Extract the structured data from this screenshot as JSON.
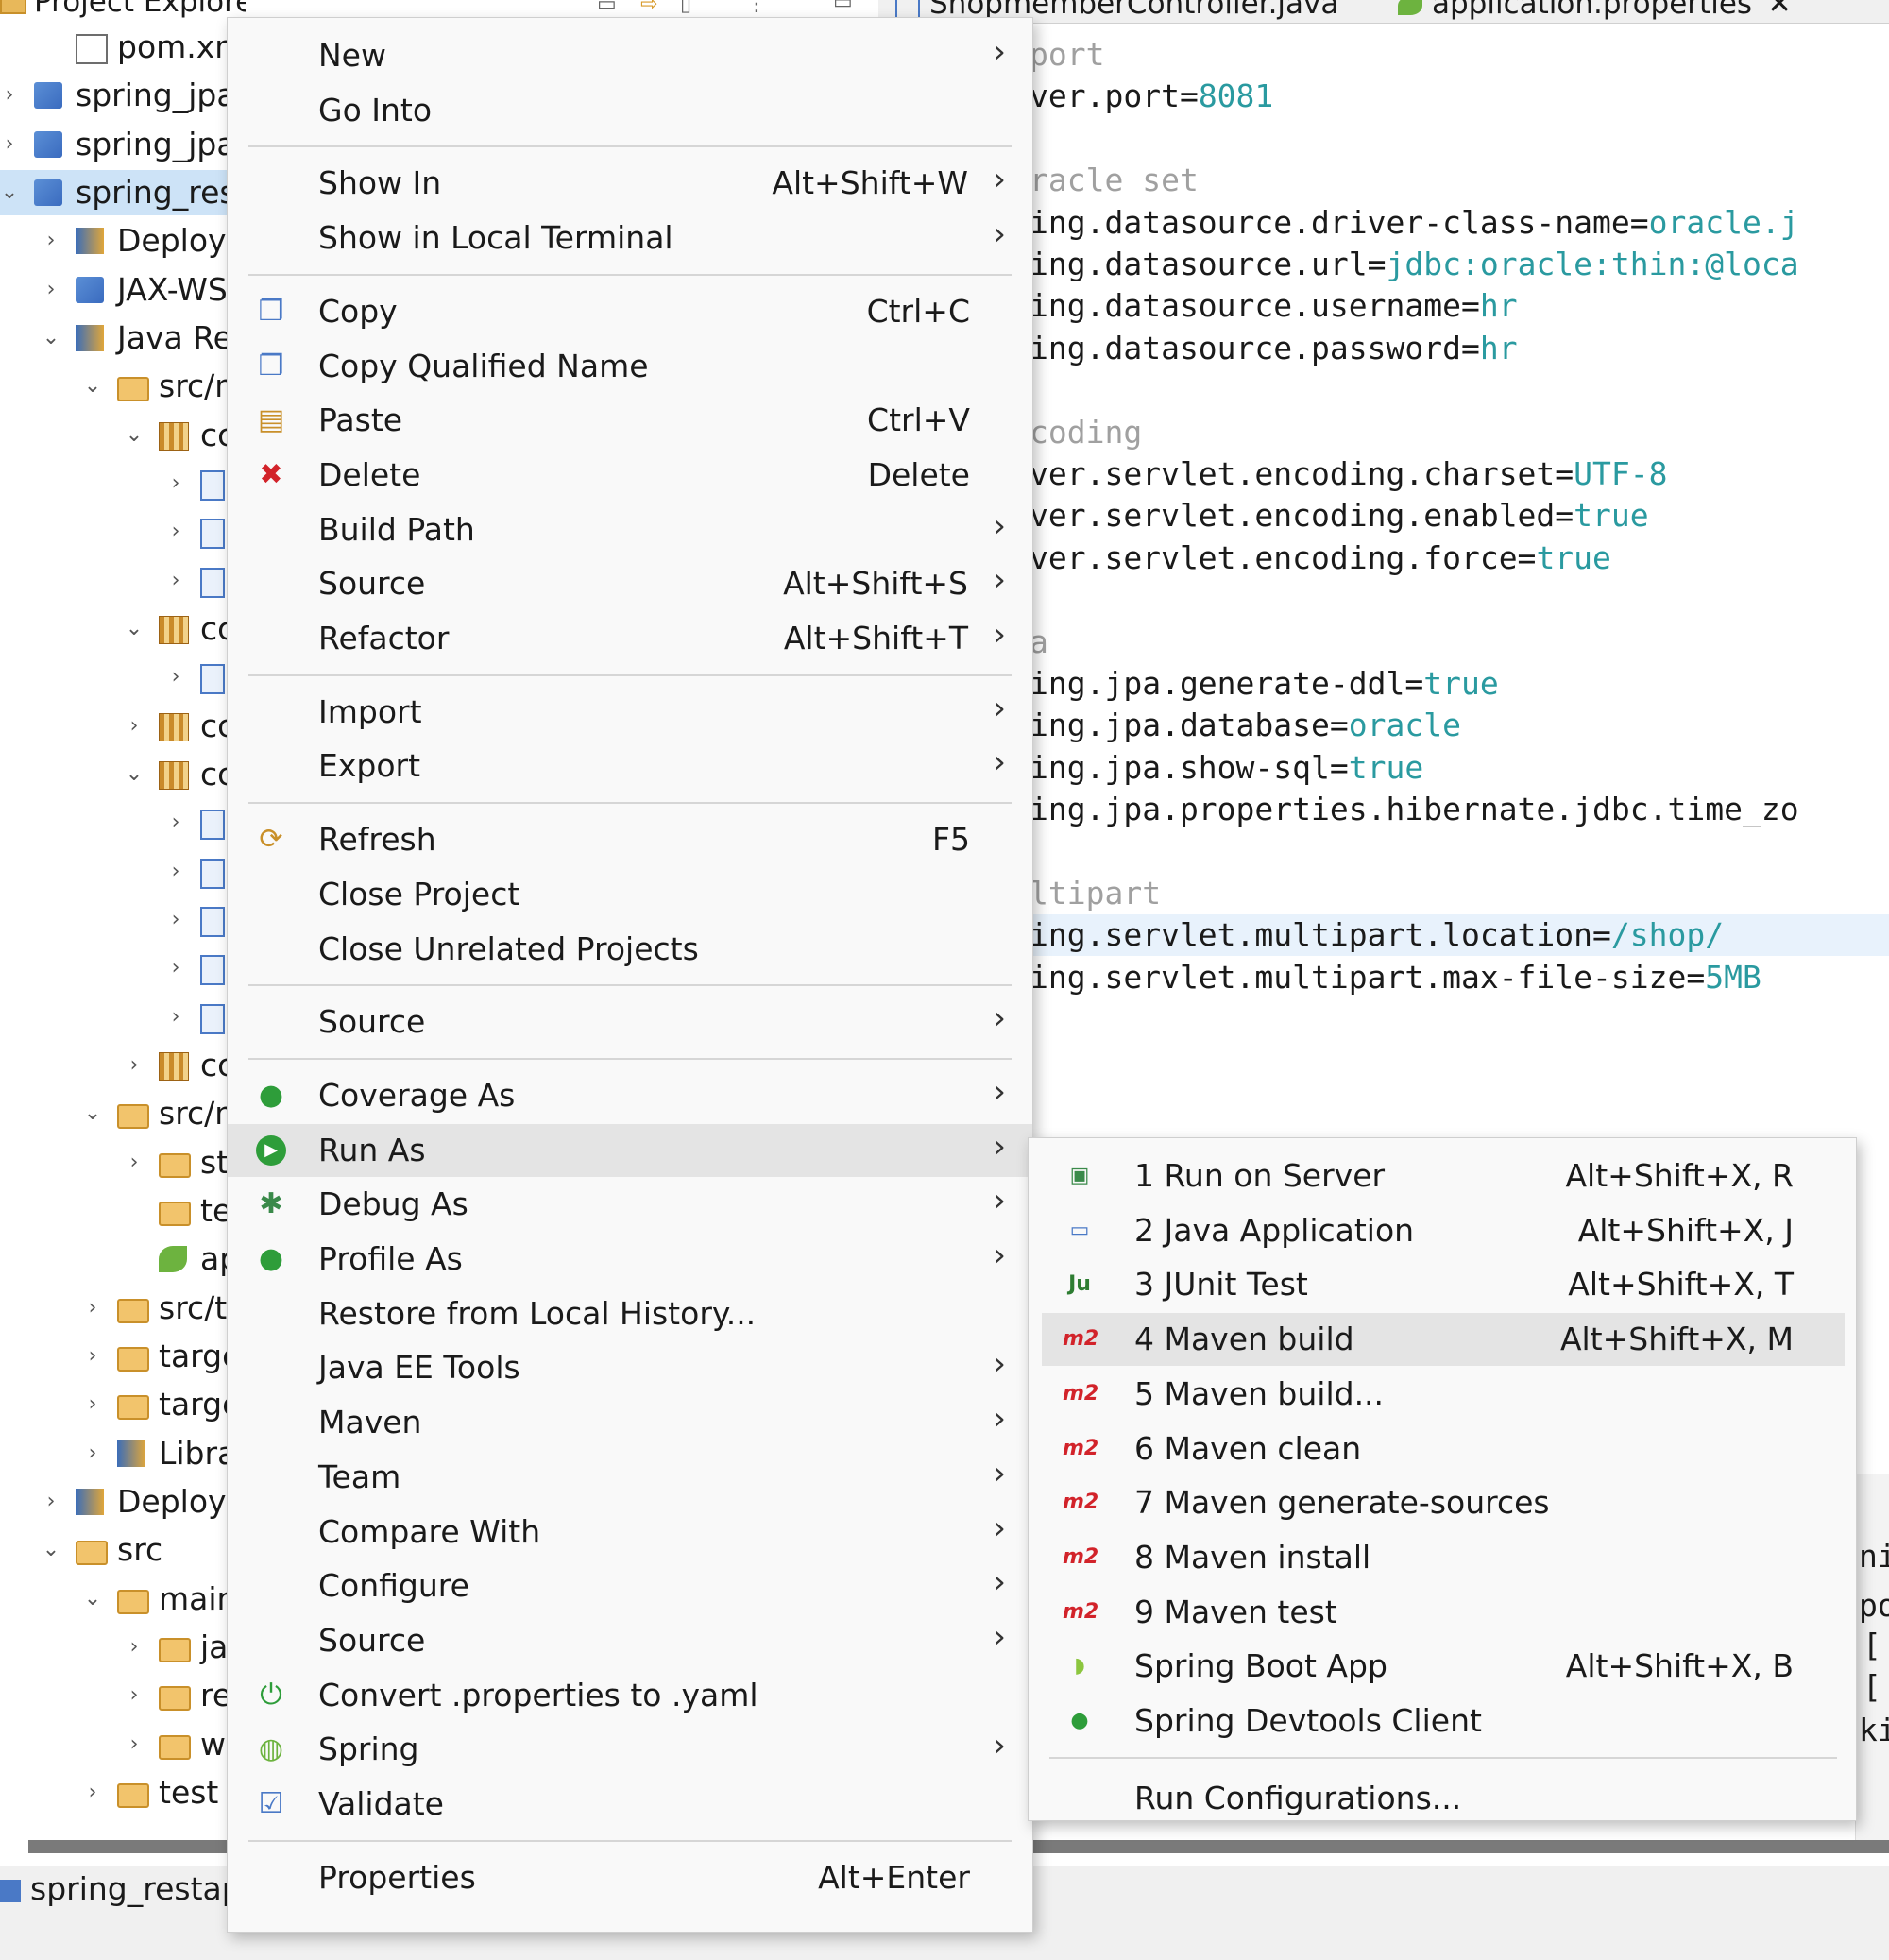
{
  "explorer": {
    "title": "Project Explorer",
    "rows": [
      {
        "label": "pom.xm",
        "chev": "",
        "icon": "xml",
        "indent": 1
      },
      {
        "label": "spring_jpa_",
        "chev": "›",
        "icon": "project",
        "indent": 0
      },
      {
        "label": "spring_jpa-",
        "chev": "›",
        "icon": "project",
        "indent": 0
      },
      {
        "label": "spring_rest",
        "chev": "⌄",
        "icon": "project",
        "indent": 0,
        "selected": true
      },
      {
        "label": "Deploy",
        "chev": "›",
        "icon": "deploy",
        "indent": 1
      },
      {
        "label": "JAX-WS",
        "chev": "›",
        "icon": "jaxws",
        "indent": 1
      },
      {
        "label": "Java Re",
        "chev": "⌄",
        "icon": "lib",
        "indent": 1
      },
      {
        "label": "src/n",
        "chev": "⌄",
        "icon": "folder",
        "indent": 2
      },
      {
        "label": "cc",
        "chev": "⌄",
        "icon": "pkg",
        "indent": 3
      },
      {
        "label": "",
        "chev": "›",
        "icon": "java",
        "indent": 4
      },
      {
        "label": "",
        "chev": "›",
        "icon": "java",
        "indent": 4
      },
      {
        "label": "",
        "chev": "›",
        "icon": "java",
        "indent": 4
      },
      {
        "label": "cc",
        "chev": "⌄",
        "icon": "pkg",
        "indent": 3
      },
      {
        "label": "",
        "chev": "›",
        "icon": "java",
        "indent": 4
      },
      {
        "label": "cc",
        "chev": "›",
        "icon": "pkg",
        "indent": 3
      },
      {
        "label": "cc",
        "chev": "⌄",
        "icon": "pkg",
        "indent": 3
      },
      {
        "label": "",
        "chev": "›",
        "icon": "java",
        "indent": 4
      },
      {
        "label": "",
        "chev": "›",
        "icon": "java",
        "indent": 4
      },
      {
        "label": "",
        "chev": "›",
        "icon": "java",
        "indent": 4
      },
      {
        "label": "",
        "chev": "›",
        "icon": "java",
        "indent": 4
      },
      {
        "label": "",
        "chev": "›",
        "icon": "java",
        "indent": 4
      },
      {
        "label": "cc",
        "chev": "›",
        "icon": "pkg",
        "indent": 3
      },
      {
        "label": "src/n",
        "chev": "⌄",
        "icon": "folder",
        "indent": 2
      },
      {
        "label": "st",
        "chev": "›",
        "icon": "folder",
        "indent": 3
      },
      {
        "label": "te",
        "chev": "",
        "icon": "folder",
        "indent": 3
      },
      {
        "label": "ap",
        "chev": "",
        "icon": "leaf",
        "indent": 3
      },
      {
        "label": "src/t",
        "chev": "›",
        "icon": "folder",
        "indent": 2
      },
      {
        "label": "targe",
        "chev": "›",
        "icon": "folder",
        "indent": 2
      },
      {
        "label": "targe",
        "chev": "›",
        "icon": "folder",
        "indent": 2
      },
      {
        "label": "Libra",
        "chev": "›",
        "icon": "lib",
        "indent": 2
      },
      {
        "label": "Deploye",
        "chev": "›",
        "icon": "deploy",
        "indent": 1
      },
      {
        "label": "src",
        "chev": "⌄",
        "icon": "folder",
        "indent": 1
      },
      {
        "label": "main",
        "chev": "⌄",
        "icon": "folder",
        "indent": 2
      },
      {
        "label": "ja",
        "chev": "›",
        "icon": "folder",
        "indent": 3
      },
      {
        "label": "re",
        "chev": "›",
        "icon": "folder",
        "indent": 3
      },
      {
        "label": "w",
        "chev": "›",
        "icon": "folder",
        "indent": 3
      },
      {
        "label": "test",
        "chev": "›",
        "icon": "folder",
        "indent": 2
      }
    ]
  },
  "editor": {
    "tabs": [
      "ShopmemberController.java",
      "application.properties"
    ],
    "lines": [
      {
        "parts": [
          {
            "t": "port",
            "c": "cm"
          }
        ],
        "comment": true
      },
      {
        "parts": [
          {
            "t": "ver.port=",
            "c": "k"
          },
          {
            "t": "8081",
            "c": "v"
          }
        ]
      },
      {
        "parts": [],
        "blank": true
      },
      {
        "parts": [
          {
            "t": "racle set",
            "c": "cm"
          }
        ],
        "comment": true
      },
      {
        "parts": [
          {
            "t": "ing.datasource.driver-class-name=",
            "c": "k"
          },
          {
            "t": "oracle.j",
            "c": "v"
          }
        ]
      },
      {
        "parts": [
          {
            "t": "ing.datasource.url=",
            "c": "k"
          },
          {
            "t": "jdbc:oracle:thin:@loca",
            "c": "v"
          }
        ]
      },
      {
        "parts": [
          {
            "t": "ing.datasource.username=",
            "c": "k"
          },
          {
            "t": "hr",
            "c": "v"
          }
        ]
      },
      {
        "parts": [
          {
            "t": "ing.datasource.password=",
            "c": "k"
          },
          {
            "t": "hr",
            "c": "v"
          }
        ]
      },
      {
        "parts": [],
        "blank": true
      },
      {
        "parts": [
          {
            "t": "coding",
            "c": "cm"
          }
        ],
        "comment": true
      },
      {
        "parts": [
          {
            "t": "ver.servlet.encoding.charset=",
            "c": "k"
          },
          {
            "t": "UTF-8",
            "c": "v"
          }
        ]
      },
      {
        "parts": [
          {
            "t": "ver.servlet.encoding.enabled=",
            "c": "k"
          },
          {
            "t": "true",
            "c": "v"
          }
        ]
      },
      {
        "parts": [
          {
            "t": "ver.servlet.encoding.force=",
            "c": "k"
          },
          {
            "t": "true",
            "c": "v"
          }
        ]
      },
      {
        "parts": [],
        "blank": true
      },
      {
        "parts": [
          {
            "t": "a",
            "c": "cm"
          }
        ],
        "comment": true
      },
      {
        "parts": [
          {
            "t": "ing.jpa.generate-ddl=",
            "c": "k"
          },
          {
            "t": "true",
            "c": "v"
          }
        ]
      },
      {
        "parts": [
          {
            "t": "ing.jpa.database=",
            "c": "k"
          },
          {
            "t": "oracle",
            "c": "v"
          }
        ]
      },
      {
        "parts": [
          {
            "t": "ing.jpa.show-sql=",
            "c": "k"
          },
          {
            "t": "true",
            "c": "v"
          }
        ]
      },
      {
        "parts": [
          {
            "t": "ing.jpa.properties.hibernate.jdbc.time_zo",
            "c": "k"
          }
        ]
      },
      {
        "parts": [],
        "blank": true
      },
      {
        "parts": [
          {
            "t": "ltipart",
            "c": "cm"
          }
        ],
        "comment": true
      },
      {
        "parts": [
          {
            "t": "ing.servlet.multipart.location=",
            "c": "k"
          },
          {
            "t": "/shop/",
            "c": "v"
          }
        ],
        "highlight": true
      },
      {
        "parts": [
          {
            "t": "ing.servlet.multipart.max-file-size=",
            "c": "k"
          },
          {
            "t": "5MB",
            "c": "v"
          }
        ]
      }
    ]
  },
  "context_menu": {
    "items": [
      {
        "label": "New",
        "shortcut": "",
        "submenu": true,
        "icon": "",
        "name": "new"
      },
      {
        "label": "Go Into",
        "shortcut": "",
        "submenu": false,
        "icon": "",
        "name": "go-into"
      },
      {
        "sep": true
      },
      {
        "label": "Show In",
        "shortcut": "Alt+Shift+W",
        "submenu": true,
        "icon": "",
        "name": "show-in"
      },
      {
        "label": "Show in Local Terminal",
        "shortcut": "",
        "submenu": true,
        "icon": "",
        "name": "show-in-local-terminal"
      },
      {
        "sep": true
      },
      {
        "label": "Copy",
        "shortcut": "Ctrl+C",
        "submenu": false,
        "icon": "copy",
        "name": "copy"
      },
      {
        "label": "Copy Qualified Name",
        "shortcut": "",
        "submenu": false,
        "icon": "copy-qualified",
        "name": "copy-qualified-name"
      },
      {
        "label": "Paste",
        "shortcut": "Ctrl+V",
        "submenu": false,
        "icon": "paste",
        "name": "paste"
      },
      {
        "label": "Delete",
        "shortcut": "Delete",
        "submenu": false,
        "icon": "delete",
        "name": "delete"
      },
      {
        "label": "Build Path",
        "shortcut": "",
        "submenu": true,
        "icon": "",
        "name": "build-path"
      },
      {
        "label": "Source",
        "shortcut": "Alt+Shift+S",
        "submenu": true,
        "icon": "",
        "name": "source"
      },
      {
        "label": "Refactor",
        "shortcut": "Alt+Shift+T",
        "submenu": true,
        "icon": "",
        "name": "refactor"
      },
      {
        "sep": true
      },
      {
        "label": "Import",
        "shortcut": "",
        "submenu": true,
        "icon": "",
        "name": "import"
      },
      {
        "label": "Export",
        "shortcut": "",
        "submenu": true,
        "icon": "",
        "name": "export"
      },
      {
        "sep": true
      },
      {
        "label": "Refresh",
        "shortcut": "F5",
        "submenu": false,
        "icon": "refresh",
        "name": "refresh"
      },
      {
        "label": "Close Project",
        "shortcut": "",
        "submenu": false,
        "icon": "",
        "name": "close-project"
      },
      {
        "label": "Close Unrelated Projects",
        "shortcut": "",
        "submenu": false,
        "icon": "",
        "name": "close-unrelated-projects"
      },
      {
        "sep": true
      },
      {
        "label": "Source",
        "shortcut": "",
        "submenu": true,
        "icon": "",
        "name": "source-2"
      },
      {
        "sep": true
      },
      {
        "label": "Coverage As",
        "shortcut": "",
        "submenu": true,
        "icon": "coverage",
        "name": "coverage-as"
      },
      {
        "label": "Run As",
        "shortcut": "",
        "submenu": true,
        "icon": "run",
        "name": "run-as",
        "hover": true
      },
      {
        "label": "Debug As",
        "shortcut": "",
        "submenu": true,
        "icon": "debug",
        "name": "debug-as"
      },
      {
        "label": "Profile As",
        "shortcut": "",
        "submenu": true,
        "icon": "profile",
        "name": "profile-as"
      },
      {
        "label": "Restore from Local History...",
        "shortcut": "",
        "submenu": false,
        "icon": "",
        "name": "restore-local-history"
      },
      {
        "label": "Java EE Tools",
        "shortcut": "",
        "submenu": true,
        "icon": "",
        "name": "java-ee-tools"
      },
      {
        "label": "Maven",
        "shortcut": "",
        "submenu": true,
        "icon": "",
        "name": "maven"
      },
      {
        "label": "Team",
        "shortcut": "",
        "submenu": true,
        "icon": "",
        "name": "team"
      },
      {
        "label": "Compare With",
        "shortcut": "",
        "submenu": true,
        "icon": "",
        "name": "compare-with"
      },
      {
        "label": "Configure",
        "shortcut": "",
        "submenu": true,
        "icon": "",
        "name": "configure"
      },
      {
        "label": "Source",
        "shortcut": "",
        "submenu": true,
        "icon": "",
        "name": "source-3"
      },
      {
        "label": "Convert .properties to .yaml",
        "shortcut": "",
        "submenu": false,
        "icon": "convert",
        "name": "convert-properties-yaml"
      },
      {
        "label": "Spring",
        "shortcut": "",
        "submenu": true,
        "icon": "spring",
        "name": "spring"
      },
      {
        "label": "Validate",
        "shortcut": "",
        "submenu": false,
        "icon": "validate",
        "name": "validate"
      },
      {
        "sep": true
      },
      {
        "label": "Properties",
        "shortcut": "Alt+Enter",
        "submenu": false,
        "icon": "",
        "name": "properties"
      }
    ]
  },
  "run_as_menu": {
    "items": [
      {
        "label": "1 Run on Server",
        "shortcut": "Alt+Shift+X, R",
        "icon": "server",
        "name": "run-on-server"
      },
      {
        "label": "2 Java Application",
        "shortcut": "Alt+Shift+X, J",
        "icon": "java-app",
        "name": "java-application"
      },
      {
        "label": "3 JUnit Test",
        "shortcut": "Alt+Shift+X, T",
        "icon": "junit",
        "name": "junit-test"
      },
      {
        "label": "4 Maven build",
        "shortcut": "Alt+Shift+X, M",
        "icon": "m2",
        "name": "maven-build",
        "hover": true
      },
      {
        "label": "5 Maven build...",
        "shortcut": "",
        "icon": "m2",
        "name": "maven-build-dialog"
      },
      {
        "label": "6 Maven clean",
        "shortcut": "",
        "icon": "m2",
        "name": "maven-clean"
      },
      {
        "label": "7 Maven generate-sources",
        "shortcut": "",
        "icon": "m2",
        "name": "maven-generate-sources"
      },
      {
        "label": "8 Maven install",
        "shortcut": "",
        "icon": "m2",
        "name": "maven-install"
      },
      {
        "label": "9 Maven test",
        "shortcut": "",
        "icon": "m2",
        "name": "maven-test"
      },
      {
        "label": "Spring Boot App",
        "shortcut": "Alt+Shift+X, B",
        "icon": "spring-boot",
        "name": "spring-boot-app"
      },
      {
        "label": "Spring Devtools Client",
        "shortcut": "",
        "icon": "devtools",
        "name": "spring-devtools-client"
      },
      {
        "sep": true
      },
      {
        "label": "Run Configurations...",
        "shortcut": "",
        "icon": "",
        "name": "run-configurations"
      }
    ]
  },
  "right_fragments": [
    "ni",
    "po",
    "[",
    "[",
    "ki"
  ],
  "status": {
    "project": "spring_restapi"
  }
}
